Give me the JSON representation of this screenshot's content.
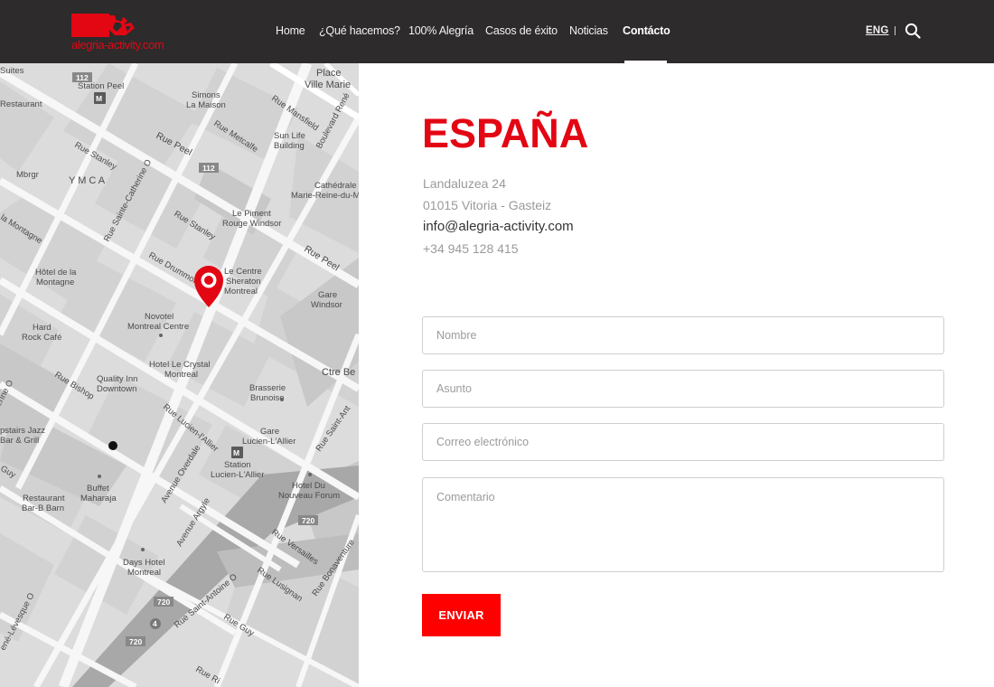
{
  "header": {
    "logo_text": "alegria-activity.com",
    "nav": [
      {
        "label": "Home"
      },
      {
        "label": "¿Qué hacemos?"
      },
      {
        "label": "100% Alegría"
      },
      {
        "label": "Casos de éxito"
      },
      {
        "label": "Noticias"
      },
      {
        "label": "Contácto",
        "active": true
      }
    ],
    "lang": "ENG",
    "search_icon": "search-icon"
  },
  "map": {
    "marker_icon": "map-pin-icon",
    "labels": {
      "suites": "Suites",
      "place": "Place",
      "ville_marie": "Ville Marie",
      "station_peel": "Station Peel",
      "restaurant_top": "Restaurant",
      "simons": "Simons",
      "la_maison": "La Maison",
      "rue_mansfield": "Rue Mansfield",
      "boulevard_rene": "Boulevard René",
      "rue_peel_1": "Rue Peel",
      "rue_metcalfe": "Rue Metcalfe",
      "sun_life": "Sun Life",
      "building": "Building",
      "rue_stanley_1": "Rue Stanley",
      "mbrgr": "Mbrgr",
      "ymca": "Y M C A",
      "rue_ste_catherine": "Rue Sainte-Catherine O",
      "cathedrale_1": "Cathédrale",
      "cathedrale_2": "Marie-Reine-du-M",
      "la_montagne": "la Montagne",
      "rue_stanley_2": "Rue Stanley",
      "le_piment": "Le Piment",
      "rouge_windsor": "Rouge Windsor",
      "rue_peel_2": "Rue Peel",
      "hotel_montagne_1": "Hôtel de la",
      "hotel_montagne_2": "Montagne",
      "rue_drummond": "Rue Drummond",
      "le_centre": "Le Centre",
      "sheraton": "Sheraton",
      "montreal_1": "Montreal",
      "gare_windsor_1": "Gare",
      "gare_windsor_2": "Windsor",
      "hard_rock_1": "Hard",
      "hard_rock_2": "Rock Café",
      "novotel_1": "Novotel",
      "novotel_2": "Montreal Centre",
      "hotel_crystal_1": "Hotel Le Crystal",
      "hotel_crystal_2": "Montreal",
      "ctre_bell": "Ctre Be",
      "quality_inn_1": "Quality Inn",
      "quality_inn_2": "Downtown",
      "rue_bishop": "Rue Bishop",
      "brasserie_1": "Brasserie",
      "brasserie_2": "Brunoise",
      "rue_lucien": "Rue Lucien-l'Allier",
      "gare_lucien_1": "Gare",
      "gare_lucien_2": "Lucien-L'Allier",
      "rue_st_antoine_top": "Rue Saint-Ant",
      "upstairs_1": "pstairs Jazz",
      "upstairs_2": "Bar & Grill",
      "station_lucien_1": "Station",
      "station_lucien_2": "Lucien-L'Allier",
      "buffet_1": "Buffet",
      "buffet_2": "Maharaja",
      "avenue_overdale": "Avenue Overdale",
      "hotel_du_1": "Hotel Du",
      "hotel_du_2": "Nouveau Forum",
      "restaurant_bb_1": "Restaurant",
      "restaurant_bb_2": "Bar-B Barn",
      "guy_left": "Guy",
      "avenue_argyle": "Avenue Argyle",
      "rue_versailles": "Rue Versailles",
      "rue_bonaventure": "Rue Bonaventure",
      "days_hotel_1": "Days Hotel",
      "days_hotel_2": "Montreal",
      "rue_lusignan": "Rue Lusignan",
      "rue_st_antoine": "Rue Saint-Antoine O",
      "rue_guy": "Rue Guy",
      "levesque": "ené-Lévesque O",
      "rue_richmond": "Rue Ri",
      "shield_112": "112",
      "shield_720": "720",
      "shield_4": "4",
      "metro_m": "M",
      "eine_o": "erine O"
    }
  },
  "contact": {
    "heading": "ESPAÑA",
    "address_line1": "Landaluzea 24",
    "address_line2": "01015 Vitoria - Gasteiz",
    "email": "info@alegria-activity.com",
    "phone": "+34 945 128 415"
  },
  "form": {
    "name_placeholder": "Nombre",
    "subject_placeholder": "Asunto",
    "email_placeholder": "Correo electrónico",
    "comment_placeholder": "Comentario",
    "submit_label": "ENVIAR"
  },
  "colors": {
    "accent": "#e30613",
    "button": "#ff0000",
    "header_bg": "#2d2b2b"
  }
}
